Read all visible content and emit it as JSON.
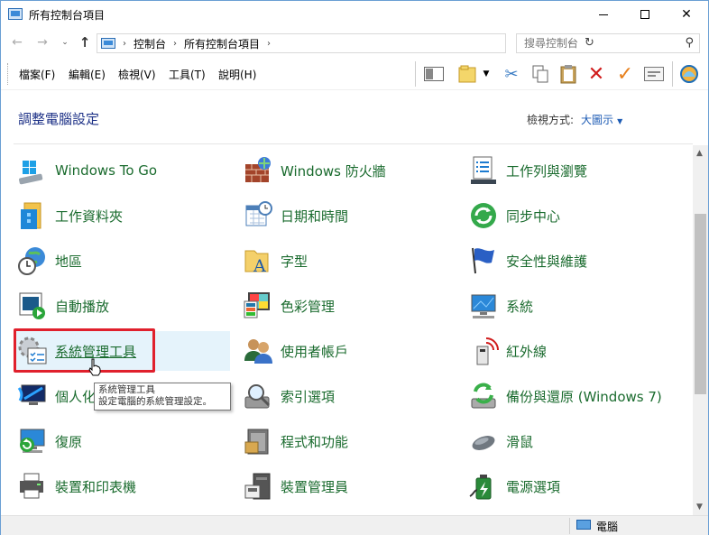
{
  "window": {
    "title": "所有控制台項目",
    "minimize": "—",
    "close": "✕"
  },
  "address": {
    "crumbs": [
      "控制台",
      "所有控制台項目"
    ],
    "search_placeholder": "搜尋控制台"
  },
  "menu": [
    "檔案(F)",
    "編輯(E)",
    "檢視(V)",
    "工具(T)",
    "說明(H)"
  ],
  "content": {
    "title": "調整電腦設定",
    "view_label": "檢視方式:",
    "view_value": "大圖示"
  },
  "items": [
    {
      "label": "Windows To Go",
      "icon": "usb-drive-icon"
    },
    {
      "label": "Windows 防火牆",
      "icon": "firewall-icon"
    },
    {
      "label": "工作列與瀏覽",
      "icon": "taskbar-icon"
    },
    {
      "label": "工作資料夾",
      "icon": "work-folders-icon"
    },
    {
      "label": "日期和時間",
      "icon": "calendar-clock-icon"
    },
    {
      "label": "同步中心",
      "icon": "sync-icon"
    },
    {
      "label": "地區",
      "icon": "globe-clock-icon"
    },
    {
      "label": "字型",
      "icon": "font-folder-icon"
    },
    {
      "label": "安全性與維護",
      "icon": "flag-icon"
    },
    {
      "label": "自動播放",
      "icon": "autoplay-icon"
    },
    {
      "label": "色彩管理",
      "icon": "color-management-icon"
    },
    {
      "label": "系統",
      "icon": "system-monitor-icon"
    },
    {
      "label": "系統管理工具",
      "icon": "admin-tools-icon"
    },
    {
      "label": "使用者帳戶",
      "icon": "users-icon"
    },
    {
      "label": "紅外線",
      "icon": "infrared-icon"
    },
    {
      "label": "個人化",
      "icon": "personalization-icon"
    },
    {
      "label": "索引選項",
      "icon": "indexing-icon"
    },
    {
      "label": "備份與還原 (Windows 7)",
      "icon": "backup-icon"
    },
    {
      "label": "復原",
      "icon": "recovery-icon"
    },
    {
      "label": "程式和功能",
      "icon": "programs-icon"
    },
    {
      "label": "滑鼠",
      "icon": "mouse-icon"
    },
    {
      "label": "裝置和印表機",
      "icon": "printer-icon"
    },
    {
      "label": "裝置管理員",
      "icon": "device-manager-icon"
    },
    {
      "label": "電源選項",
      "icon": "power-icon"
    }
  ],
  "tooltip": {
    "line1": "系統管理工具",
    "line2": "設定電腦的系統管理設定。"
  },
  "status": {
    "computer_label": "電腦"
  }
}
